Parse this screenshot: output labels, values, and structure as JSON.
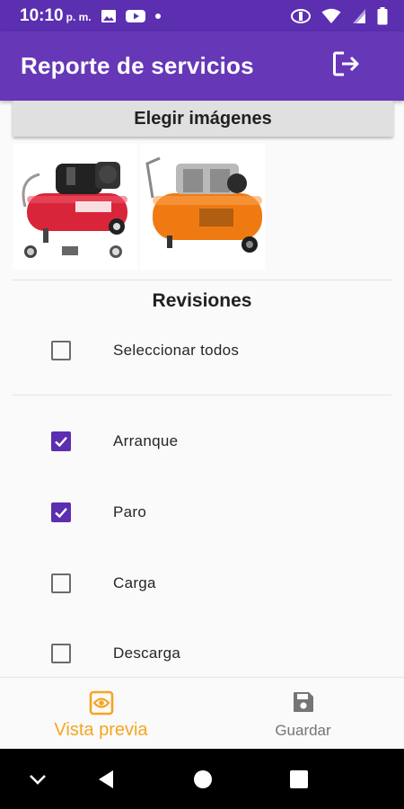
{
  "status_bar": {
    "time": "10:10",
    "ampm": "p. m."
  },
  "app_bar": {
    "title": "Reporte de servicios",
    "logout_icon": "logout-icon"
  },
  "choose_images_label": "Elegir imágenes",
  "images": [
    {
      "name": "red-air-compressor",
      "color": "#d8253a"
    },
    {
      "name": "orange-air-compressor",
      "color": "#f07a12"
    }
  ],
  "revisiones": {
    "title": "Revisiones",
    "select_all": {
      "label": "Seleccionar todos",
      "checked": false
    },
    "items": [
      {
        "label": "Arranque",
        "checked": true
      },
      {
        "label": "Paro",
        "checked": true
      },
      {
        "label": "Carga",
        "checked": false
      },
      {
        "label": "Descarga",
        "checked": false
      }
    ]
  },
  "bottom_nav": {
    "preview": {
      "label": "Vista previa",
      "icon": "eye-icon",
      "active": true
    },
    "save": {
      "label": "Guardar",
      "icon": "save-icon",
      "active": false
    }
  },
  "colors": {
    "primary": "#6638b8",
    "primary_dark": "#5b2fb0",
    "accent": "#f5a521"
  }
}
